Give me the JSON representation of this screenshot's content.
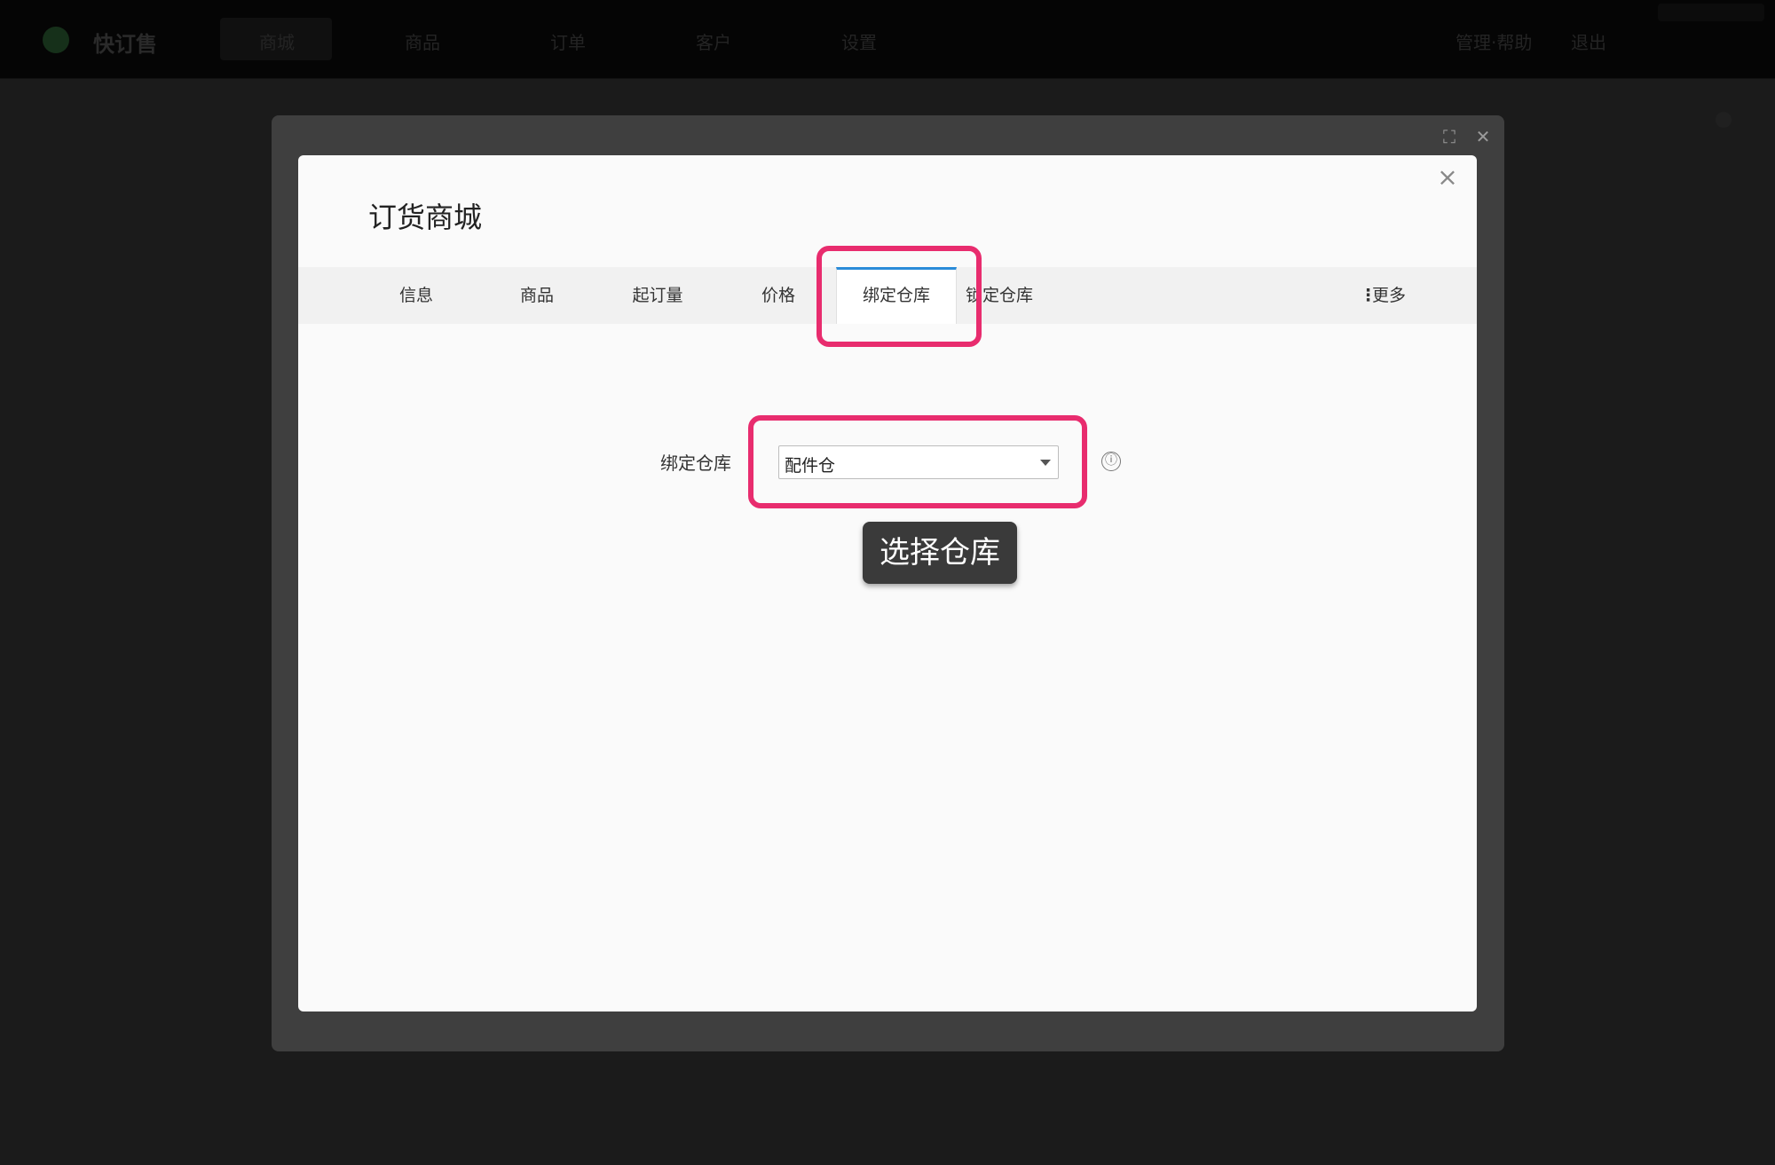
{
  "topbar": {
    "brand": "快订售",
    "nav": [
      "商城",
      "商品",
      "订单",
      "客户",
      "设置"
    ],
    "right": [
      "管理·帮助",
      "退出"
    ]
  },
  "modal": {
    "title": "订货商城",
    "close_label": "×",
    "tabs": [
      {
        "label": "信息"
      },
      {
        "label": "商品"
      },
      {
        "label": "起订量"
      },
      {
        "label": "价格"
      },
      {
        "label": "绑定仓库"
      },
      {
        "label": "锁定仓库"
      }
    ],
    "more_label": "更多"
  },
  "form": {
    "warehouse_label": "绑定仓库",
    "warehouse_value": "配件仓",
    "info_icon": "ⓘ"
  },
  "tooltip": {
    "text": "选择仓库"
  },
  "colors": {
    "highlight": "#e82c6e",
    "active_tab_accent": "#2a8bd8"
  }
}
